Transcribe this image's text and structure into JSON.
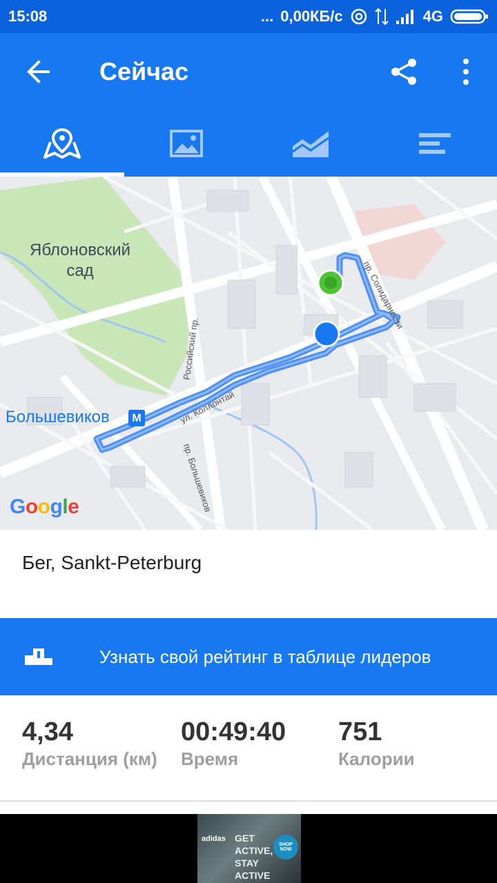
{
  "status_bar": {
    "time": "15:08",
    "dots": "...",
    "network_speed": "0,00КБ/с",
    "network_type": "4G"
  },
  "app_bar": {
    "title": "Сейчас",
    "back_icon": "arrow-left-icon",
    "share_icon": "share-icon",
    "more_icon": "more-vert-icon"
  },
  "tabs": [
    {
      "icon": "map-pin-icon",
      "active": true
    },
    {
      "icon": "image-icon",
      "active": false
    },
    {
      "icon": "chart-area-icon",
      "active": false
    },
    {
      "icon": "bar-list-icon",
      "active": false
    }
  ],
  "map": {
    "park_label": "Яблоновский сад",
    "metro_label": "Большевиков",
    "metro_icon": "М",
    "streets": [
      "Российский пр.",
      "ул. Коллонтай",
      "пр. Большевиков",
      "пр. Солидарности"
    ],
    "google_logo": "Google",
    "route_color": "#4a8ff5",
    "start_color": "#4fc336",
    "end_color": "#1778f2"
  },
  "activity": {
    "title": "Бег, Sankt-Peterburg"
  },
  "leaderboard": {
    "icon": "podium-icon",
    "text": "Узнать свой рейтинг в таблице лидеров"
  },
  "stats": [
    {
      "value": "4,34",
      "label": "Дистанция (км)"
    },
    {
      "value": "00:49:40",
      "label": "Время"
    },
    {
      "value": "751",
      "label": "Калории"
    }
  ],
  "ad": {
    "brand": "adidas",
    "headline": "GET ACTIVE, STAY ACTIVE",
    "button": "SHOP NOW"
  },
  "colors": {
    "primary": "#1778f2",
    "status_bar": "#0a63dc"
  }
}
